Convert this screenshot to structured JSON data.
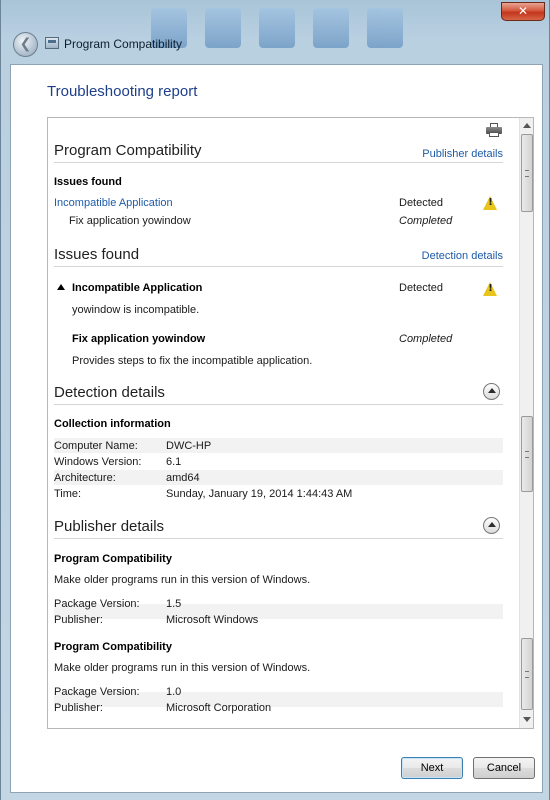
{
  "window": {
    "title": "Program Compatibility",
    "close_glyph": "✕",
    "back_glyph": "❮"
  },
  "page": {
    "heading": "Troubleshooting report"
  },
  "report": {
    "summary": {
      "title": "Program Compatibility",
      "link": "Publisher details",
      "issues_label": "Issues found",
      "rows": [
        {
          "name": "Incompatible Application",
          "status": "Detected"
        },
        {
          "name": "Fix application yowindow",
          "status": "Completed"
        }
      ]
    },
    "issues": {
      "title": "Issues found",
      "link": "Detection details",
      "issue_name": "Incompatible Application",
      "issue_status": "Detected",
      "issue_desc": "yowindow is incompatible.",
      "fix_name": "Fix application yowindow",
      "fix_status": "Completed",
      "fix_desc": "Provides steps to fix the incompatible application."
    },
    "detection": {
      "title": "Detection details",
      "subheading": "Collection information",
      "rows": [
        {
          "label": "Computer Name:",
          "value": "DWC-HP"
        },
        {
          "label": "Windows Version:",
          "value": "6.1"
        },
        {
          "label": "Architecture:",
          "value": "amd64"
        },
        {
          "label": "Time:",
          "value": "Sunday, January 19, 2014 1:44:43 AM"
        }
      ]
    },
    "publisher": {
      "title": "Publisher details",
      "entries": [
        {
          "name": "Program Compatibility",
          "desc": "Make older programs run in this version of Windows.",
          "package_label": "Package Version:",
          "package_value": "1.5",
          "publisher_label": "Publisher:",
          "publisher_value": "Microsoft Windows"
        },
        {
          "name": "Program Compatibility",
          "desc": "Make older programs run in this version of Windows.",
          "package_label": "Package Version:",
          "package_value": "1.0",
          "publisher_label": "Publisher:",
          "publisher_value": "Microsoft Corporation"
        }
      ]
    }
  },
  "buttons": {
    "next": "Next",
    "cancel": "Cancel"
  },
  "icons": {
    "warning": "warning-icon",
    "print": "print-icon",
    "collapse": "collapse-icon",
    "back": "back-arrow-icon"
  }
}
